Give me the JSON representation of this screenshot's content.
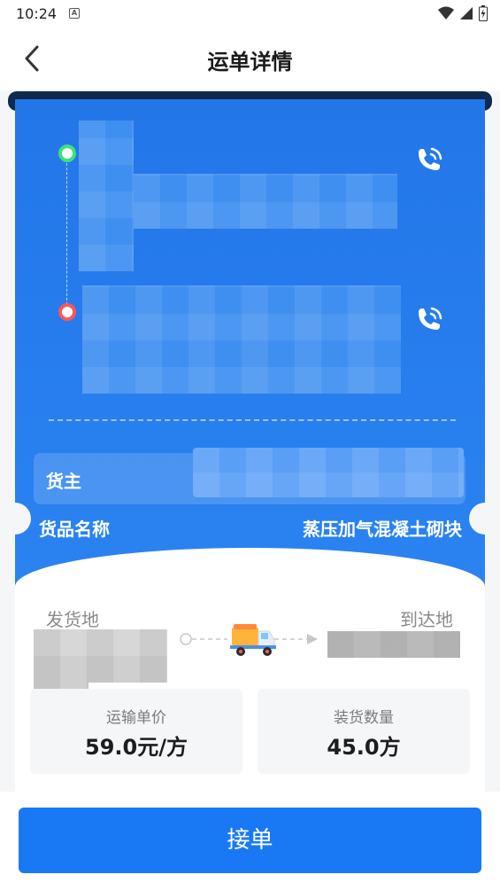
{
  "status_bar": {
    "time": "10:24",
    "notification_icon": "a-icon"
  },
  "header": {
    "title": "运单详情",
    "back_icon": "chevron-left-icon"
  },
  "route": {
    "start_dot_color": "#3ee07c",
    "end_dot_color": "#ff5656",
    "phone_icon": "phone-call-icon"
  },
  "shipper": {
    "label": "货主"
  },
  "goods": {
    "label": "货品名称",
    "value": "蒸压加气混凝土砌块"
  },
  "locations": {
    "origin_label": "发货地",
    "destination_label": "到达地"
  },
  "stats": {
    "unit_price_label": "运输单价",
    "unit_price_value": "59.0元/方",
    "quantity_label": "装货数量",
    "quantity_value": "45.0方"
  },
  "actions": {
    "accept_label": "接单"
  },
  "colors": {
    "primary": "#1979f4",
    "card_blue": "#2376e8"
  }
}
